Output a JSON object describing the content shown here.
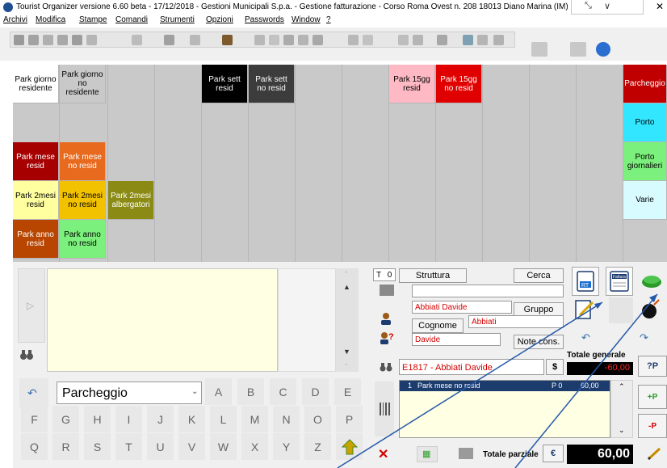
{
  "window": {
    "title": "Tourist Organizer versione 6.60 beta - 17/12/2018 - Gestioni Municipali S.p.a. - Gestione fatturazione - Corso Roma Ovest n. 208 18013 Diano Marina (IM) P.I. 013...",
    "close_glyph": "✕",
    "restore_glyph": "⤡",
    "chevron_glyph": "∨"
  },
  "menu": [
    "Archivi",
    "Modifica",
    "Stampe",
    "Comandi",
    "Strumenti",
    "Opzioni",
    "Passwords",
    "Window",
    "?"
  ],
  "grid": {
    "tiles": [
      {
        "label": "Park giorno residente",
        "col": 0,
        "row": 0,
        "bg": "#ffffff",
        "fg": "#000000"
      },
      {
        "label": "Park giorno no residente",
        "col": 1,
        "row": 0,
        "bg": "#c9c9c9",
        "fg": "#000000"
      },
      {
        "label": "Park sett resid",
        "col": 4,
        "row": 0,
        "bg": "#000000",
        "fg": "#ffffff"
      },
      {
        "label": "Park sett no resid",
        "col": 5,
        "row": 0,
        "bg": "#3c3c3c",
        "fg": "#ffffff"
      },
      {
        "label": "Park 15gg resid",
        "col": 8,
        "row": 0,
        "bg": "#ffb9c4",
        "fg": "#000000"
      },
      {
        "label": "Park 15gg no resid",
        "col": 9,
        "row": 0,
        "bg": "#e00000",
        "fg": "#ffffff"
      },
      {
        "label": "Parcheggio",
        "col": 13,
        "row": 0,
        "bg": "#c00000",
        "fg": "#ffffff"
      },
      {
        "label": "Porto",
        "col": 13,
        "row": 1,
        "bg": "#33e6ff",
        "fg": "#000000"
      },
      {
        "label": "Park mese resid",
        "col": 0,
        "row": 2,
        "bg": "#a60000",
        "fg": "#ffffff"
      },
      {
        "label": "Park mese no resid",
        "col": 1,
        "row": 2,
        "bg": "#e86a1e",
        "fg": "#ffffff"
      },
      {
        "label": "Porto giornalieri",
        "col": 13,
        "row": 2,
        "bg": "#7cf07c",
        "fg": "#000000"
      },
      {
        "label": "Park 2mesi resid",
        "col": 0,
        "row": 3,
        "bg": "#ffffa0",
        "fg": "#000000"
      },
      {
        "label": "Park 2mesi no resid",
        "col": 1,
        "row": 3,
        "bg": "#f2c200",
        "fg": "#000000"
      },
      {
        "label": "Park 2mesi albergatori",
        "col": 2,
        "row": 3,
        "bg": "#8a8a14",
        "fg": "#ffffff"
      },
      {
        "label": "Varie",
        "col": 13,
        "row": 3,
        "bg": "#d8fbff",
        "fg": "#000000"
      },
      {
        "label": "Park anno resid",
        "col": 0,
        "row": 4,
        "bg": "#b84600",
        "fg": "#ffffff"
      },
      {
        "label": "Park anno no resid",
        "col": 1,
        "row": 4,
        "bg": "#7cf07c",
        "fg": "#000000"
      }
    ]
  },
  "keypad": {
    "category_value": "Parcheggio",
    "row1": [
      "A",
      "B",
      "C",
      "D",
      "E"
    ],
    "row2": [
      "F",
      "G",
      "H",
      "I",
      "J",
      "K",
      "L",
      "M",
      "N",
      "O",
      "P"
    ],
    "row3": [
      "Q",
      "R",
      "S",
      "T",
      "U",
      "V",
      "W",
      "X",
      "Y",
      "Z"
    ]
  },
  "customer": {
    "type_code": "T",
    "type_value": "0",
    "struttura_label": "Struttura",
    "cerca_label": "Cerca",
    "struttura_value": "",
    "name_value": "Abbiati Davide",
    "gruppo_label": "Gruppo",
    "cognome_label": "Cognome",
    "cognome_value": "Abbiati",
    "first_name_value": "Davide",
    "note_label": "Note cons.",
    "account_value": "E1817 - Abbiati Davide",
    "dollar_label": "$"
  },
  "totals": {
    "totale_generale_label": "Totale generale",
    "totale_generale_value": "-60,00",
    "totale_parziale_label": "Totale parziale",
    "euro_label": "€",
    "totale_parziale_value": "60,00"
  },
  "order": {
    "lines": [
      {
        "qty": "1",
        "description": "Park mese no resid",
        "code": "P 0",
        "amount": "60,00"
      }
    ]
  },
  "side_buttons": {
    "plus_p": "+P",
    "question_p": "?P",
    "minus_p": "-P"
  },
  "icon_labels": {
    "rt_label": "RT",
    "fattura_label": "Fattura"
  },
  "colors": {
    "accent_blue": "#1d3c6e",
    "selection_bg": "#1d3c6e",
    "alert_red": "#d40000",
    "negative_red": "#ff2a2a"
  }
}
